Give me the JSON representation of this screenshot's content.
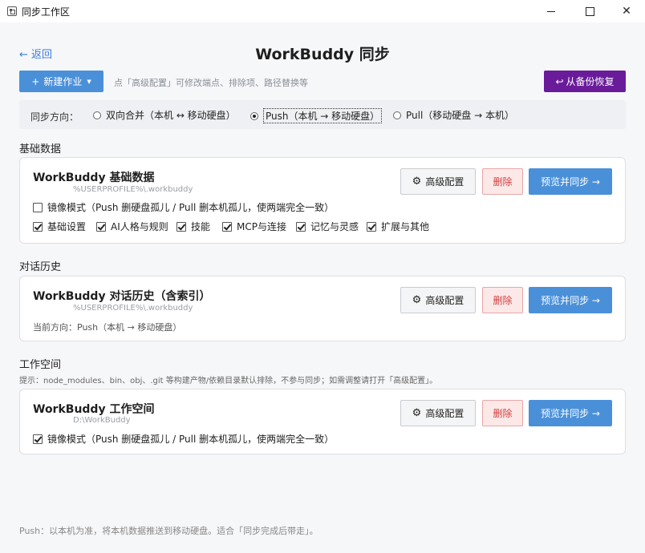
{
  "window": {
    "title": "同步工作区",
    "min_glyph": "—",
    "max_glyph": "☐",
    "close_glyph": "✕"
  },
  "header": {
    "back": "← 返回",
    "title": "WorkBuddy 同步"
  },
  "toolbar": {
    "new_job": "新建作业",
    "new_job_plus": "+",
    "new_job_caret": "▼",
    "hint": "点「高级配置」可修改端点、排除项、路径替换等",
    "restore": "从备份恢复",
    "restore_icon": "↩"
  },
  "direction": {
    "label": "同步方向：",
    "options": [
      {
        "label": "双向合并（本机 ↔ 移动硬盘）",
        "selected": false
      },
      {
        "label": "Push（本机 → 移动硬盘）",
        "selected": true
      },
      {
        "label": "Pull（移动硬盘 → 本机）",
        "selected": false
      }
    ]
  },
  "sections": {
    "basic": "基础数据",
    "history": "对话历史",
    "workspace": "工作空间"
  },
  "workspace_tip": "提示：node_modules、bin、obj、.git 等构建产物/依赖目录默认排除，不参与同步；如需调整请打开「高级配置」。",
  "buttons": {
    "advanced": "高级配置",
    "gear": "⚙",
    "delete": "删除",
    "sync": "预览并同步 →"
  },
  "cards": {
    "basic": {
      "title": "WorkBuddy 基础数据",
      "path": "%USERPROFILE%\\.workbuddy",
      "mirror_label": "镜像模式（Push 删硬盘孤儿 / Pull 删本机孤儿，使两端完全一致）",
      "mirror_checked": false,
      "items": [
        {
          "label": "基础设置",
          "checked": true
        },
        {
          "label": "AI人格与规则",
          "checked": true
        },
        {
          "label": "技能",
          "checked": true
        },
        {
          "label": "MCP与连接",
          "checked": true
        },
        {
          "label": "记忆与灵感",
          "checked": true
        },
        {
          "label": "扩展与其他",
          "checked": true
        }
      ]
    },
    "history": {
      "title": "WorkBuddy 对话历史（含索引）",
      "path": "%USERPROFILE%\\.workbuddy",
      "current_direction": "当前方向：Push（本机 → 移动硬盘）"
    },
    "workspace": {
      "title": "WorkBuddy 工作空间",
      "path": "D:\\WorkBuddy",
      "mirror_label": "镜像模式（Push 删硬盘孤儿 / Pull 删本机孤儿，使两端完全一致）",
      "mirror_checked": true
    }
  },
  "footer": "Push：以本机为准，将本机数据推送到移动硬盘。适合「同步完成后带走」。",
  "colors": {
    "primary": "#4a90d9",
    "restore": "#6a1b9a",
    "danger": "#d04040"
  }
}
